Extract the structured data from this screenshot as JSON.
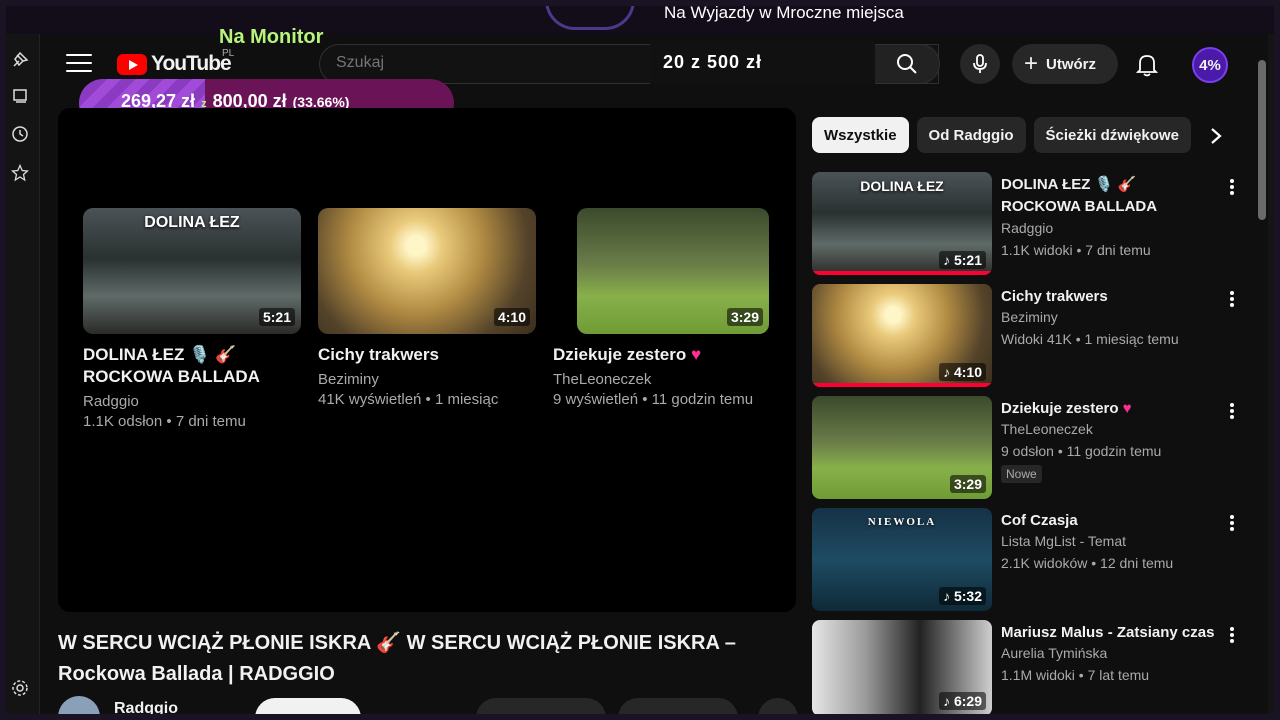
{
  "overlay": {
    "nm_label": "Na Monitor",
    "trip_label": "Na Wyjazdy w Mroczne miejsca",
    "trip_amount": "20 z 500 zł",
    "goal": {
      "current": "269,27 zł",
      "separator": "z",
      "target": "800,00 zł",
      "percent_text": "(33.66%)",
      "progress": 0.3366
    },
    "badge": "4%"
  },
  "rail": {
    "icons": [
      "pin-icon",
      "chat-icon",
      "clock-icon",
      "star-icon",
      "settings-icon"
    ]
  },
  "header": {
    "logo_text": "YouTube",
    "country": "PL",
    "search_placeholder": "Szukaj",
    "create_label": "Utwórz"
  },
  "end_screen": [
    {
      "thumb_title": "DOLINA ŁEZ",
      "duration": "5:21",
      "title": "DOLINA ŁEZ 🎙️ 🎸 ROCKOWA BALLADA",
      "channel": "Radggio",
      "meta": "1.1K odsłon • 7 dni temu"
    },
    {
      "thumb_title": "",
      "duration": "4:10",
      "title": "Cichy trakwers",
      "channel": "Beziminy",
      "meta": "41K wyświetleń • 1 miesiąc"
    },
    {
      "thumb_title": "",
      "duration": "3:29",
      "title": "Dziekuje zestero",
      "heart": "♥",
      "channel": "TheLeoneczek",
      "meta": "9 wyświetleń • 11 godzin temu"
    }
  ],
  "video": {
    "title": "W SERCU WCIĄŻ PŁONIE ISKRA 🎸 W SERCU WCIĄŻ PŁONIE ISKRA – Rockowa Ballada | RADGGIO",
    "channel": "Radggio"
  },
  "chips": [
    "Wszystkie",
    "Od Radggio",
    "Ścieżki dźwiękowe"
  ],
  "recommendations": [
    {
      "thumb_title": "DOLINA ŁEZ",
      "duration": "♪ 5:21",
      "title": "DOLINA ŁEZ 🎙️ 🎸 ROCKOWA BALLADA",
      "channel": "Radggio",
      "meta": "1.1K widoki • 7 dni temu",
      "watched": true
    },
    {
      "thumb_title": "",
      "duration": "♪ 4:10",
      "title": "Cichy trakwers",
      "channel": "Beziminy",
      "meta": "Widoki 41K • 1 miesiąc temu",
      "watched": true
    },
    {
      "thumb_title": "",
      "duration": "3:29",
      "title": "Dziekuje zestero",
      "heart": "♥",
      "channel": "TheLeoneczek",
      "meta": "9 odsłon • 11 godzin temu",
      "badge": "Nowe"
    },
    {
      "thumb_title": "NIEWOLA",
      "duration": "♪ 5:32",
      "title": "Cof Czasja",
      "channel": "Lista MgList - Temat",
      "meta": "2.1K widoków • 12 dni temu"
    },
    {
      "thumb_title": "",
      "duration": "♪ 6:29",
      "title": "Mariusz Malus - Zatsiany czas",
      "channel": "Aurelia Tymińska",
      "meta": "1.1M widoki • 7 lat temu"
    }
  ],
  "colors": {
    "accent": "#ff0033",
    "goal_fill": "#a14bd8",
    "goal_bg": "#6a1457",
    "nm_label": "#b8f37c"
  }
}
